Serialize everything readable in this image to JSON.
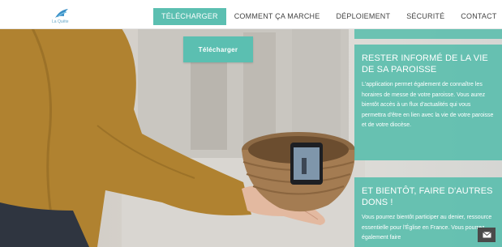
{
  "nav": {
    "items": [
      {
        "label": "TÉLÉCHARGER",
        "active": true
      },
      {
        "label": "COMMENT ÇA MARCHE",
        "active": false
      },
      {
        "label": "DÉPLOIEMENT",
        "active": false
      },
      {
        "label": "SÉCURITÉ",
        "active": false
      },
      {
        "label": "CONTACT",
        "active": false
      }
    ],
    "search_icon": "search-icon",
    "logo_text": "La Quête"
  },
  "hero": {
    "download_label": "Télécharger"
  },
  "panels": [
    {
      "title": "RESTER INFORMÉ DE LA VIE DE SA PAROISSE",
      "body": "L'application permet également de connaître les horaires de messe de votre paroisse. Vous aurez bientôt accès à un flux d'actualités qui vous permettra d'être en lien avec la vie de votre paroisse et de votre diocèse."
    },
    {
      "title": "ET BIENTÔT, FAIRE D'AUTRES DONS !",
      "body": "Vous pourrez bientôt participer au denier, ressource essentielle pour l'Église en France. Vous pourrez également faire"
    }
  ],
  "colors": {
    "accent": "#5bbfb1",
    "panel": "#57bdac",
    "sweater": "#b8862e"
  },
  "mail_icon": "mail-icon"
}
